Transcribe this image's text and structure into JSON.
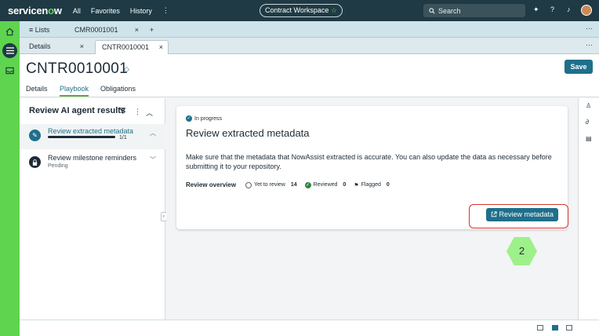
{
  "topbar": {
    "logo_main": "servicen",
    "logo_o": "o",
    "logo_end": "w",
    "nav": [
      "All",
      "Favorites",
      "History"
    ],
    "more_icon": "⋮",
    "workspace_label": "Contract Workspace",
    "workspace_star": "☆",
    "search_placeholder": "Search"
  },
  "tabs_row1": {
    "lists_label": "Lists",
    "tab_label": "CMR0001001",
    "close": "×",
    "add": "+",
    "more": "···"
  },
  "tabs_row2": {
    "details_label": "Details",
    "record_label": "CNTR0010001",
    "close": "×",
    "more": "···"
  },
  "header": {
    "title": "CNTR0010001",
    "save_label": "Save",
    "subtabs": [
      "Details",
      "Playbook",
      "Obligations"
    ]
  },
  "left_panel": {
    "title": "Review AI agent results",
    "tasks": [
      {
        "name": "Review extracted metadata",
        "count": "1/1",
        "progress": 1.0
      },
      {
        "name": "Review milestone reminders",
        "status": "Pending"
      }
    ]
  },
  "card": {
    "status": "In progress",
    "title": "Review extracted metadata",
    "description": "Make sure that the metadata that NowAssist extracted is accurate. You can also update the data as necessary before submitting it to your repository.",
    "overview_label": "Review overview",
    "yet_label": "Yet to review",
    "yet_count": "14",
    "reviewed_label": "Reviewed",
    "reviewed_count": "0",
    "flagged_label": "Flagged",
    "flagged_count": "0",
    "button_label": "Review metadata"
  },
  "step_marker": "2",
  "colors": {
    "topbar": "#1f3a44",
    "accent": "#1f6f8b",
    "brand_green": "#62d84e",
    "highlight": "#d9332e"
  }
}
